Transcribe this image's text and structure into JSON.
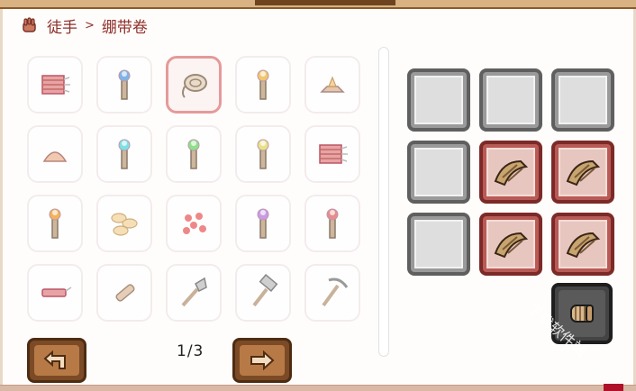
{
  "breadcrumb": {
    "root": "徒手",
    "separator": ">",
    "current": "绷带卷"
  },
  "pager": {
    "text": "1/3"
  },
  "recipes": [
    "dynamite-bundle-icon",
    "blue-torch-icon",
    "rope-coil-icon",
    "torch-icon",
    "campfire-icon",
    "dough-pile-icon",
    "cyan-torch-icon",
    "green-torch-icon",
    "yellow-torch-icon",
    "red-dynamite-bundle-icon",
    "flame-torch-icon",
    "bread-rolls-icon",
    "red-berries-icon",
    "purple-torch-icon",
    "red-torch-icon",
    "red-stick-dynamite-icon",
    "wood-stick-icon",
    "stone-shovel-icon",
    "stone-hammer-icon",
    "stone-pickaxe-icon"
  ],
  "crafting_grid": [
    [
      "empty",
      "empty",
      "empty"
    ],
    [
      "empty",
      "bandage",
      "bandage"
    ],
    [
      "empty",
      "bandage",
      "bandage"
    ]
  ],
  "result": {
    "icon": "bandage-roll-icon"
  },
  "watermark": "下载软件站",
  "colors": {
    "accent": "#8e2f2a",
    "selected_border": "#e59a9a",
    "wood": "#7b4a26"
  }
}
